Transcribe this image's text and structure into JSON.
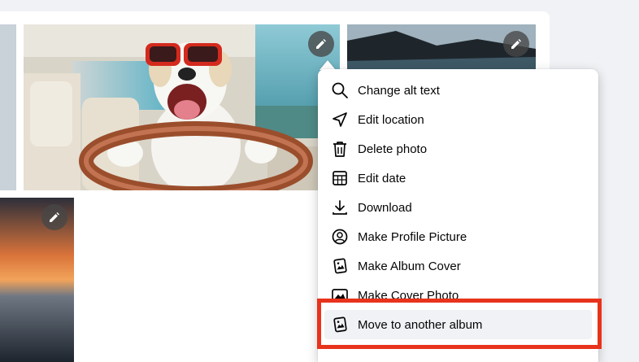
{
  "photos": [
    {
      "name": "Dog driving car",
      "edit_icon": "pencil-icon"
    },
    {
      "name": "Coastal landscape",
      "edit_icon": "pencil-icon"
    },
    {
      "name": "Sunset over water",
      "edit_icon": "pencil-icon"
    }
  ],
  "menu": {
    "items": [
      {
        "label": "Change alt text",
        "icon": "search-icon"
      },
      {
        "label": "Edit location",
        "icon": "location-arrow-icon"
      },
      {
        "label": "Delete photo",
        "icon": "trash-icon"
      },
      {
        "label": "Edit date",
        "icon": "calendar-icon"
      },
      {
        "label": "Download",
        "icon": "download-icon"
      },
      {
        "label": "Make Profile Picture",
        "icon": "profile-icon"
      },
      {
        "label": "Make Album Cover",
        "icon": "album-icon"
      },
      {
        "label": "Make Cover Photo",
        "icon": "image-icon"
      },
      {
        "label": "Move to another album",
        "icon": "album-move-icon"
      }
    ],
    "selected_index": 8
  },
  "colors": {
    "highlight": "#e8331c",
    "menu_bg": "#ffffff",
    "page_bg": "#f0f2f5"
  }
}
